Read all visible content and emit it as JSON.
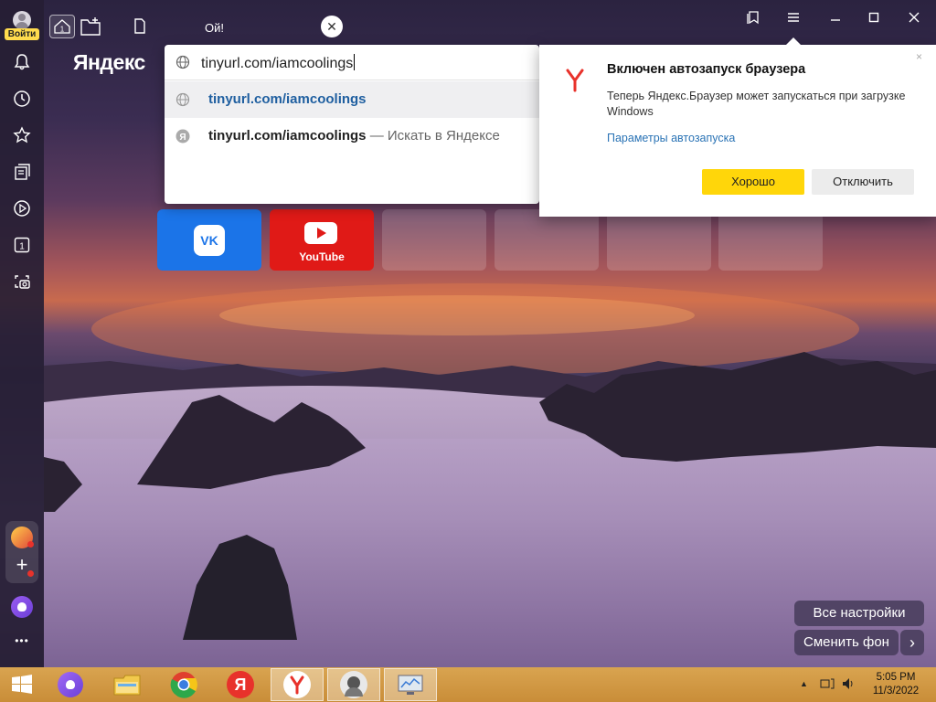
{
  "sidebar": {
    "login_label": "Войти",
    "items": [
      {
        "icon": "bell-icon"
      },
      {
        "icon": "history-icon"
      },
      {
        "icon": "star-icon"
      },
      {
        "icon": "collections-icon"
      },
      {
        "icon": "play-icon"
      },
      {
        "icon": "tabs-count-icon",
        "count": "1"
      },
      {
        "icon": "screenshot-icon"
      }
    ],
    "more_label": "•••"
  },
  "topbar": {
    "home_tab_count": "1",
    "tab_title": "Ой!",
    "close_label": "✕"
  },
  "brand": "Яндекс",
  "omnibox": {
    "value": "tinyurl.com/iamcoolings",
    "suggestions": [
      {
        "text": "tinyurl.com/iamcoolings",
        "icon": "globe-icon"
      },
      {
        "text": "tinyurl.com/iamcoolings",
        "suffix": " — Искать в Яндексе",
        "icon": "yandex-icon"
      }
    ]
  },
  "popup": {
    "title": "Включен автозапуск браузера",
    "body": "Теперь Яндекс.Браузер может запускаться при загрузке Windows",
    "link": "Параметры автозапуска",
    "ok_label": "Хорошо",
    "disable_label": "Отключить",
    "close_label": "×"
  },
  "tiles": [
    {
      "name": "VK",
      "logo": "vk-logo"
    },
    {
      "name": "YouTube",
      "label": "YouTube"
    }
  ],
  "bottom_buttons": {
    "all_settings": "Все настройки",
    "change_bg": "Сменить фон",
    "chevron": "›"
  },
  "taskbar": {
    "time": "5:05 PM",
    "date": "11/3/2022"
  },
  "colors": {
    "accent_yellow": "#ffd60a",
    "link_blue": "#2a73b5",
    "vk_blue": "#1b74e8",
    "youtube_red": "#e01a17"
  }
}
